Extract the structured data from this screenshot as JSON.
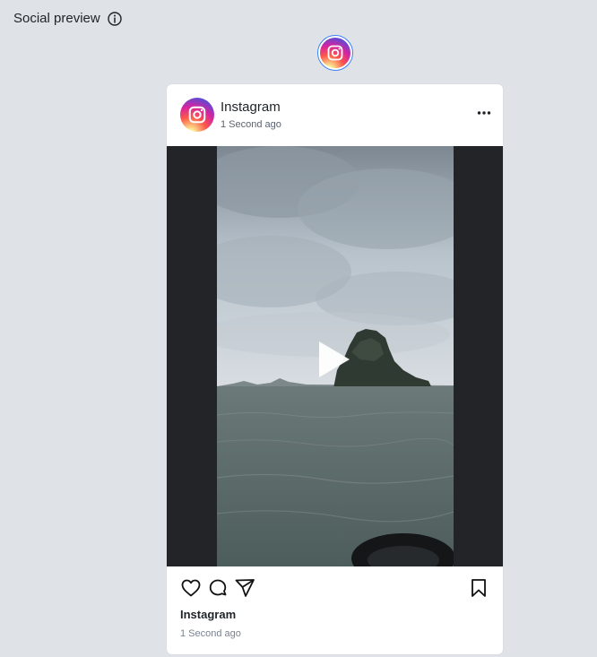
{
  "header": {
    "title": "Social preview",
    "info_icon": "info-icon"
  },
  "platforms": [
    {
      "name": "instagram",
      "icon": "instagram-icon",
      "selected": true
    }
  ],
  "post": {
    "account_name": "Instagram",
    "time": "1 Second ago",
    "more_icon": "more-horizontal-icon",
    "media": {
      "type": "video",
      "play_icon": "play-icon"
    },
    "actions": {
      "like_icon": "heart-icon",
      "comment_icon": "comment-icon",
      "share_icon": "send-icon",
      "save_icon": "bookmark-icon"
    },
    "caption_name": "Instagram",
    "caption_time": "1 Second ago"
  },
  "colors": {
    "page_background": "#dfe3e8",
    "card_background": "#ffffff",
    "media_background": "#222427",
    "selected_border": "#3b82f6"
  }
}
